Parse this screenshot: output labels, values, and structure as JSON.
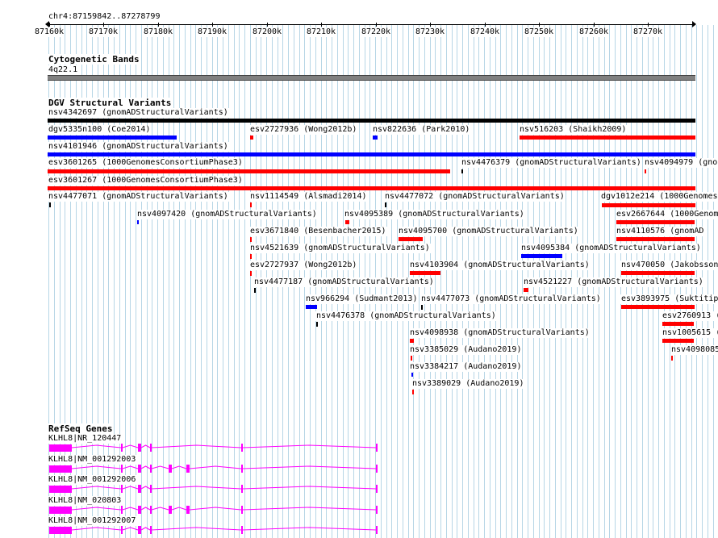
{
  "ruler": {
    "coord_label": "chr4:87159842..87278799",
    "tick_labels": [
      "87160k",
      "87170k",
      "87180k",
      "87190k",
      "87200k",
      "87210k",
      "87220k",
      "87230k",
      "87240k",
      "87250k",
      "87260k",
      "87270k"
    ]
  },
  "tracks": {
    "cytoband": {
      "title": "Cytogenetic Bands",
      "band_label": "4q22.1"
    },
    "dgv": {
      "title": "DGV Structural Variants"
    },
    "refseq": {
      "title": "RefSeq Genes"
    }
  },
  "colors": {
    "gain": "#0000ff",
    "loss": "#ff0000",
    "complex": "#000000",
    "gene": "#ff00ff",
    "band": "#808080",
    "grid": "#b7d6e6"
  },
  "dgv_features": [
    {
      "label": "nsv4342697 (gnomADStructuralVariants)",
      "color": "#000000"
    },
    {
      "label": "dgv5335n100 (Coe2014)",
      "color": "#0000ff"
    },
    {
      "label": "esv2727936 (Wong2012b)",
      "color": "#ff0000"
    },
    {
      "label": "nsv822636 (Park2010)",
      "color": "#0000ff"
    },
    {
      "label": "nsv516203 (Shaikh2009)",
      "color": "#ff0000"
    },
    {
      "label": "nsv4101946 (gnomADStructuralVariants)",
      "color": "#0000ff"
    },
    {
      "label": "esv3601265 (1000GenomesConsortiumPhase3)",
      "color": "#ff0000"
    },
    {
      "label": "nsv4476379 (gnomADStructuralVariants)",
      "color": "#000000"
    },
    {
      "label": "nsv4094979 (gno",
      "color": "#ff0000"
    },
    {
      "label": "esv3601267 (1000GenomesConsortiumPhase3)",
      "color": "#ff0000"
    },
    {
      "label": "nsv4477071 (gnomADStructuralVariants)",
      "color": "#000000"
    },
    {
      "label": "nsv1114549 (Alsmadi2014)",
      "color": "#ff0000"
    },
    {
      "label": "nsv4477072 (gnomADStructuralVariants)",
      "color": "#000000"
    },
    {
      "label": "dgv1012e214 (1000Genomes",
      "color": "#ff0000"
    },
    {
      "label": "nsv4097420 (gnomADStructuralVariants)",
      "color": "#0000ff"
    },
    {
      "label": "nsv4095389 (gnomADStructuralVariants)",
      "color": "#ff0000"
    },
    {
      "label": "esv2667644 (1000Genom",
      "color": "#ff0000"
    },
    {
      "label": "esv3671840 (Besenbacher2015)",
      "color": "#ff0000"
    },
    {
      "label": "nsv4095700 (gnomADStructuralVariants)",
      "color": "#ff0000"
    },
    {
      "label": "nsv4110576 (gnomAD",
      "color": "#ff0000"
    },
    {
      "label": "nsv4521639 (gnomADStructuralVariants)",
      "color": "#ff0000"
    },
    {
      "label": "nsv4095384 (gnomADStructuralVariants)",
      "color": "#0000ff"
    },
    {
      "label": "esv2727937 (Wong2012b)",
      "color": "#ff0000"
    },
    {
      "label": "nsv4103904 (gnomADStructuralVariants)",
      "color": "#ff0000"
    },
    {
      "label": "nsv470050 (Jakobsson",
      "color": "#ff0000"
    },
    {
      "label": "nsv4477187 (gnomADStructuralVariants)",
      "color": "#000000"
    },
    {
      "label": "nsv4521227 (gnomADStructuralVariants)",
      "color": "#ff0000"
    },
    {
      "label": "nsv966294 (Sudmant2013)",
      "color": "#0000ff"
    },
    {
      "label": "nsv4477073 (gnomADStructuralVariants)",
      "color": "#000000"
    },
    {
      "label": "esv3893975 (Suktitip",
      "color": "#ff0000"
    },
    {
      "label": "nsv4476378 (gnomADStructuralVariants)",
      "color": "#000000"
    },
    {
      "label": "esv2760913 (",
      "color": "#ff0000"
    },
    {
      "label": "nsv4098938 (gnomADStructuralVariants)",
      "color": "#ff0000"
    },
    {
      "label": "nsv1005615 (",
      "color": "#ff0000"
    },
    {
      "label": "nsv3385029 (Audano2019)",
      "color": "#ff0000"
    },
    {
      "label": "nsv4098085",
      "color": "#ff0000"
    },
    {
      "label": "nsv3384217 (Audano2019)",
      "color": "#0000ff"
    },
    {
      "label": "nsv3389029 (Audano2019)",
      "color": "#ff0000"
    }
  ],
  "genes": [
    {
      "label": "KLHL8|NR_120447"
    },
    {
      "label": "KLHL8|NM_001292003"
    },
    {
      "label": "KLHL8|NM_001292006"
    },
    {
      "label": "KLHL8|NM_020803"
    },
    {
      "label": "KLHL8|NM_001292007"
    }
  ]
}
